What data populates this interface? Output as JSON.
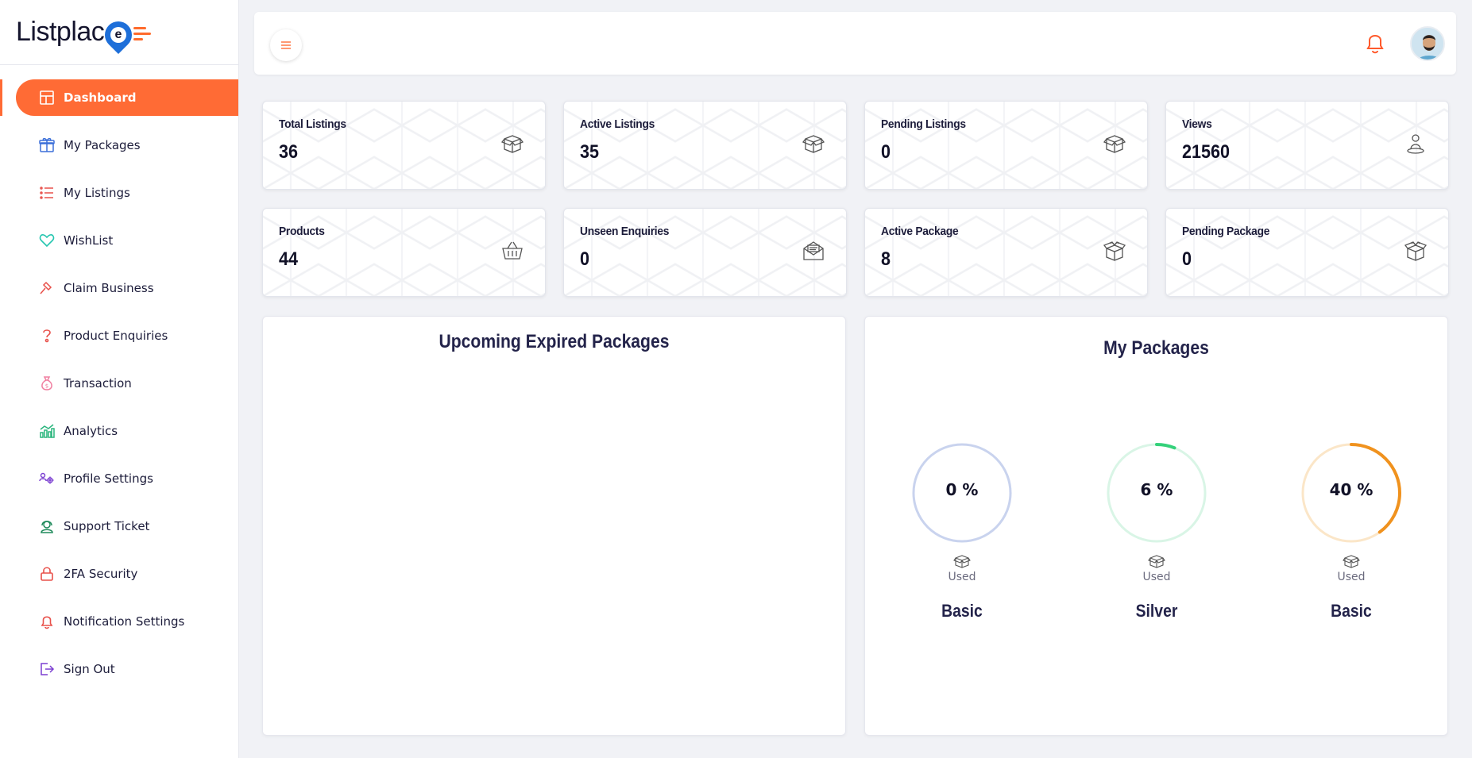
{
  "brand": {
    "name_part": "Listplac",
    "pin_letter": "e",
    "accent": "#ff6b35"
  },
  "sidebar": {
    "items": [
      {
        "label": "Dashboard",
        "icon": "grid-icon",
        "active": true
      },
      {
        "label": "My Packages",
        "icon": "gift-icon"
      },
      {
        "label": "My Listings",
        "icon": "list-icon"
      },
      {
        "label": "WishList",
        "icon": "heart-icon"
      },
      {
        "label": "Claim Business",
        "icon": "hammer-icon"
      },
      {
        "label": "Product Enquiries",
        "icon": "question-icon"
      },
      {
        "label": "Transaction",
        "icon": "money-bag-icon"
      },
      {
        "label": "Analytics",
        "icon": "analytics-icon"
      },
      {
        "label": "Profile Settings",
        "icon": "users-gear-icon"
      },
      {
        "label": "Support Ticket",
        "icon": "support-icon"
      },
      {
        "label": "2FA Security",
        "icon": "lock-icon"
      },
      {
        "label": "Notification Settings",
        "icon": "bell-icon"
      },
      {
        "label": "Sign Out",
        "icon": "sign-out-icon"
      }
    ]
  },
  "stats": [
    {
      "label": "Total Listings",
      "value": "36",
      "icon": "box-icon"
    },
    {
      "label": "Active Listings",
      "value": "35",
      "icon": "box-icon"
    },
    {
      "label": "Pending Listings",
      "value": "0",
      "icon": "box-icon"
    },
    {
      "label": "Views",
      "value": "21560",
      "icon": "user-stand-icon"
    },
    {
      "label": "Products",
      "value": "44",
      "icon": "basket-icon"
    },
    {
      "label": "Unseen Enquiries",
      "value": "0",
      "icon": "mail-open-icon"
    },
    {
      "label": "Active Package",
      "value": "8",
      "icon": "gift-box-icon"
    },
    {
      "label": "Pending Package",
      "value": "0",
      "icon": "gift-box-icon"
    }
  ],
  "panels": {
    "expired_title": "Upcoming Expired Packages",
    "packages_title": "My Packages"
  },
  "packages": [
    {
      "pct_label": "0 %",
      "progress": 0,
      "used_label": "Used",
      "name": "Basic",
      "color": "#1e3a8a",
      "track": "#c9d3ee"
    },
    {
      "pct_label": "6 %",
      "progress": 0.06,
      "used_label": "Used",
      "name": "Silver",
      "color": "#34d17a",
      "track": "#d9f5e6"
    },
    {
      "pct_label": "40 %",
      "progress": 0.4,
      "used_label": "Used",
      "name": "Basic",
      "color": "#f0921e",
      "track": "#fbe6c8"
    }
  ]
}
